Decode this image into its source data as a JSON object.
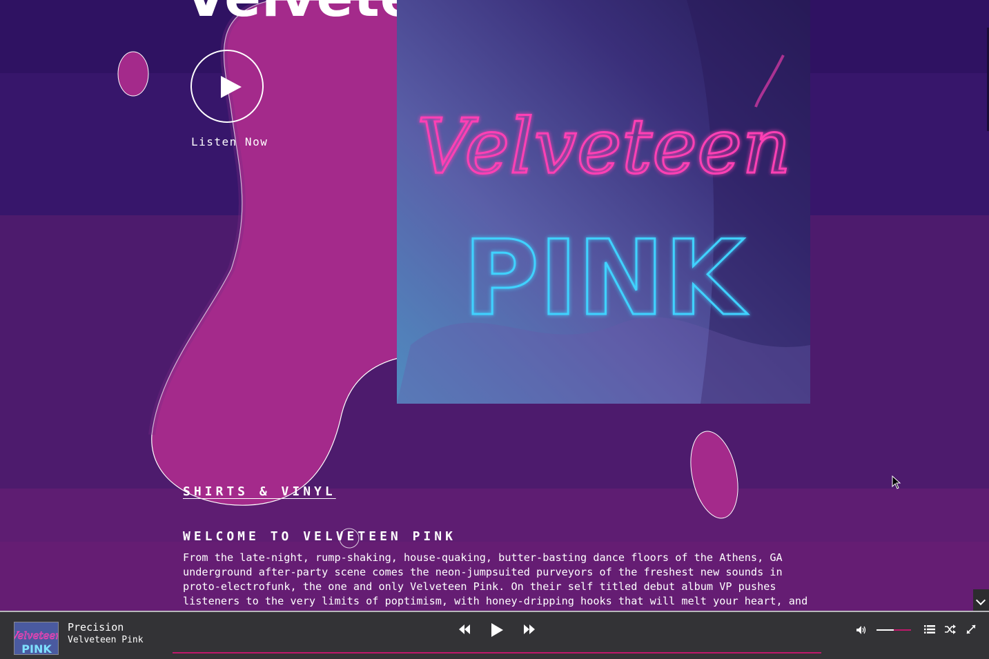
{
  "hero": {
    "title": "Velveteen Pink",
    "listen_label": "Listen Now"
  },
  "album_art": {
    "script_word": "Velveteen",
    "block_word": "PINK"
  },
  "content": {
    "shirts_link": "SHIRTS & VINYL",
    "welcome_title": "WELCOME TO VELVETEEN PINK",
    "welcome_body": "From the late-night, rump-shaking, house-quaking, butter-basting dance floors of the Athens, GA underground after-party scene comes the neon-jumpsuited purveyors of the freshest new sounds in proto-electrofunk, the one and only Velveteen Pink. On their self titled debut album VP pushes listeners to the very limits of poptimism, with honey-dripping hooks that will melt your heart, and"
  },
  "player": {
    "track_title": "Precision",
    "track_artist": "Velveteen Pink",
    "thumb_script": "Velveteen",
    "thumb_block": "PINK",
    "volume_level": 0.5,
    "icons": [
      "rewind-icon",
      "play-icon",
      "fast-forward-icon",
      "volume-icon",
      "queue-list-icon",
      "shuffle-icon",
      "fullscreen-icon",
      "chevron-down-icon"
    ]
  },
  "colors": {
    "blob_magenta": "#a42a8b",
    "bg_dark_purple": "#2f1262",
    "player_bg": "#333336",
    "accent_pink": "#c0186b",
    "neon_pink": "#ff3fb4",
    "neon_cyan": "#3fd2ff"
  }
}
